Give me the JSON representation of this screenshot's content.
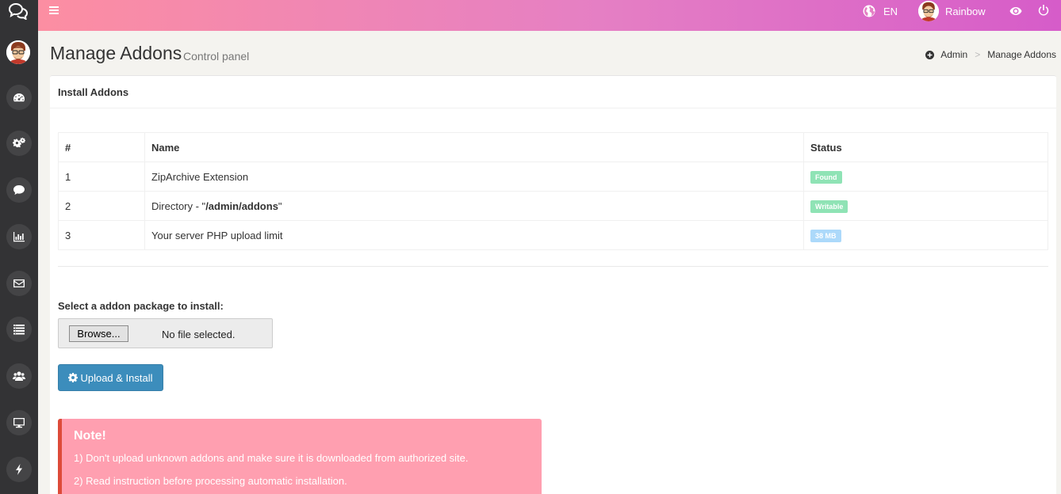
{
  "topbar": {
    "language": "EN",
    "username": "Rainbow"
  },
  "header": {
    "title": "Manage Addons",
    "subtitle": "Control panel",
    "breadcrumb": [
      "Admin",
      "Manage Addons"
    ]
  },
  "box": {
    "title": "Install Addons",
    "table": {
      "headers": [
        "#",
        "Name",
        "Status"
      ],
      "rows": [
        {
          "num": "1",
          "name": "ZipArchive Extension",
          "status": "Found"
        },
        {
          "num": "2",
          "name_prefix": "Directory - \"",
          "name_bold": "/admin/addons",
          "name_suffix": "\"",
          "status": "Writable"
        },
        {
          "num": "3",
          "name": "Your server PHP upload limit",
          "status": "38 MB"
        }
      ]
    },
    "select_label": "Select a addon package to install:",
    "browse_label": "Browse...",
    "file_status": "No file selected.",
    "upload_label": "Upload & Install"
  },
  "note": {
    "title": "Note!",
    "lines": [
      "1) Don't upload unknown addons and make sure it is downloaded from authorized site.",
      "2) Read instruction before processing automatic installation."
    ]
  },
  "sidebar": {
    "icons": [
      "dashboard-icon",
      "cogs-icon",
      "comments-icon",
      "bar-chart-icon",
      "envelope-icon",
      "list-icon",
      "users-icon",
      "desktop-icon",
      "bolt-icon"
    ]
  },
  "colors": {
    "topbar_start": "#fc8ea2",
    "topbar_end": "#d65cc9",
    "sidebar": "#333335",
    "primary": "#3c8dbc",
    "success_label": "#8fe3b5",
    "info_label": "#acd9fa",
    "note_bg": "#ff9fb0",
    "note_border": "#dd4b39"
  }
}
